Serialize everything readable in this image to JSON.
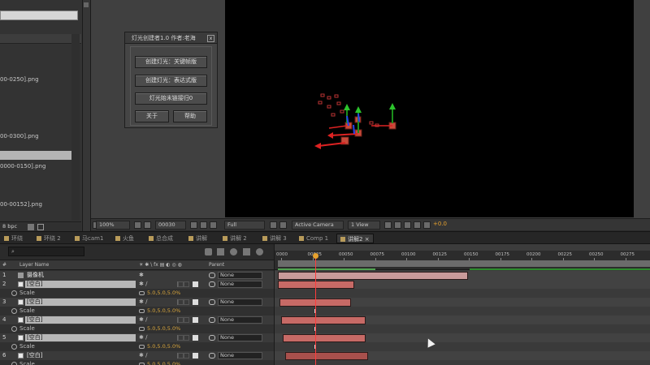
{
  "project_panel": {
    "files": [
      {
        "label": "00-0250].png"
      },
      {
        "label": "00-0300].png"
      },
      {
        "label": "0000-0150].png"
      },
      {
        "label": "00-00152].png"
      }
    ],
    "bottom_bpc": "8 bpc"
  },
  "plugin_dialog": {
    "title": "灯光创建者1.0  作者:老海",
    "close_label": "x",
    "buttons": [
      "创建灯光：关键帧版",
      "创建灯光：表达式版",
      "灯光始末链接归0"
    ],
    "about_label": "关于",
    "help_label": "帮助"
  },
  "viewer_bar": {
    "zoom": "100%",
    "timecode": "00030",
    "resolution": "Full",
    "camera": "Active Camera",
    "view": "1 View",
    "exposure": "+0.0"
  },
  "tabs": [
    {
      "label": "环绕"
    },
    {
      "label": "环绕 2"
    },
    {
      "label": "马cam1"
    },
    {
      "label": "火鱼"
    },
    {
      "label": "总合成"
    },
    {
      "label": "讲解"
    },
    {
      "label": "讲解 2"
    },
    {
      "label": "讲解 3"
    },
    {
      "label": "Comp 1"
    },
    {
      "label": "讲解2"
    }
  ],
  "timeline": {
    "search_placeholder": "",
    "col_layer_name": "Layer Name",
    "col_parent": "Parent",
    "col_switches": "☀ ✱ \\ fx ▤ ◐ ◎ ◍",
    "parent_none": "None",
    "scale_label": "Scale",
    "scale_value": "5.0,5.0,5.0%",
    "layers": [
      {
        "num": "1",
        "name": "摄像机",
        "is_camera": true
      },
      {
        "num": "2",
        "name": "[空白]"
      },
      {
        "num": "3",
        "name": "[空白]"
      },
      {
        "num": "4",
        "name": "[空白]"
      },
      {
        "num": "5",
        "name": "[空白]"
      },
      {
        "num": "6",
        "name": "[空白]"
      }
    ],
    "ruler_labels": [
      "0000",
      "00025",
      "00050",
      "00075",
      "00100",
      "00125",
      "00150",
      "00175",
      "00200",
      "00225",
      "00250",
      "00275"
    ]
  },
  "colors": {
    "layer_bar": "#c76a66",
    "camera_bar": "#c99a9a",
    "playhead": "#ff3b3b",
    "accent_value": "#d6a43c"
  }
}
